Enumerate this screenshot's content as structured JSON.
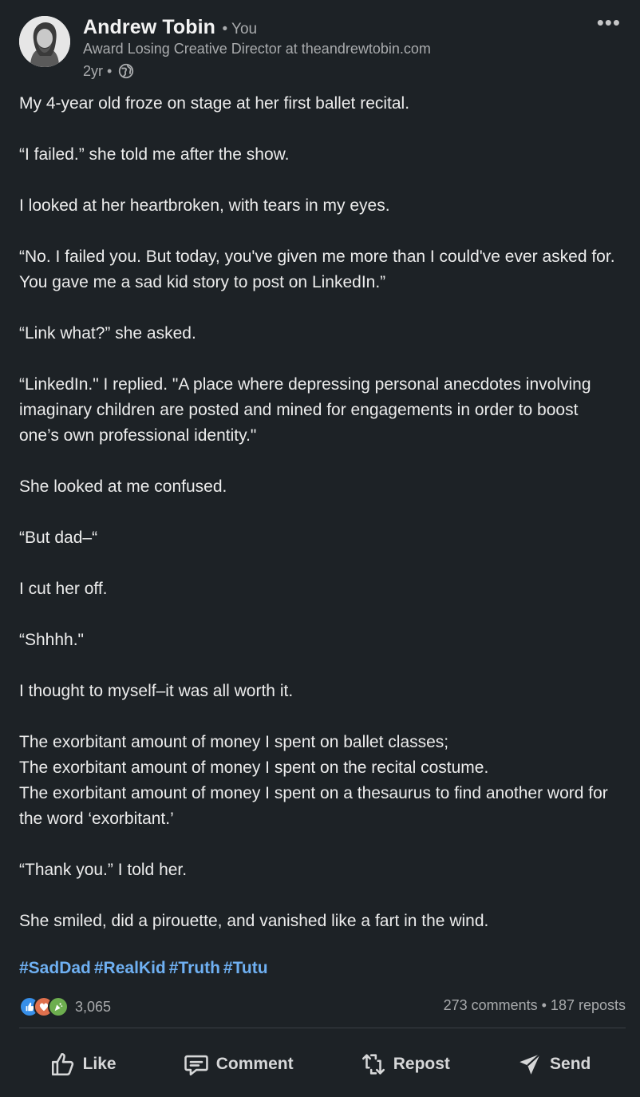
{
  "author": {
    "name": "Andrew Tobin",
    "relation": "• You",
    "headline": "Award Losing Creative Director at theandrewtobin.com",
    "time": "2yr •"
  },
  "menu_icon": "•••",
  "post": {
    "paragraphs": [
      "My 4-year old froze on stage at her first ballet recital.",
      "“I failed.” she told me after the show.",
      "I looked at her heartbroken, with tears in my eyes.",
      "“No. I failed you. But today, you've given me more than I could've ever asked for. You gave me a sad kid story to post on LinkedIn.”",
      "“Link what?” she asked.",
      "“LinkedIn.\" I replied. \"A place where depressing personal anecdotes involving imaginary children are posted and mined for engagements in order to boost one’s own professional identity.\"",
      "She looked at me confused.",
      "“But dad–“",
      "I cut her off.",
      "“Shhhh.\"",
      "I thought to myself–it was all worth it.",
      "The exorbitant amount of money I spent on ballet classes;",
      "The exorbitant amount of money I spent on the recital costume.",
      "The exorbitant amount of money I spent on a thesaurus to find another word for the word ‘exorbitant.’",
      "“Thank you.” I told her.",
      "She smiled, did a pirouette, and vanished like a fart in the wind."
    ],
    "hashtags": [
      "#SadDad",
      "#RealKid",
      "#Truth",
      "#Tutu"
    ]
  },
  "social": {
    "reaction_count": "3,065",
    "comments_reposts": "273 comments • 187 reposts",
    "reaction_icons": [
      "like-icon",
      "love-icon",
      "celebrate-icon"
    ]
  },
  "actions": {
    "like": "Like",
    "comment": "Comment",
    "repost": "Repost",
    "send": "Send"
  },
  "colors": {
    "background": "#1d2226",
    "link": "#6fb0f2",
    "muted": "#a9abad"
  }
}
